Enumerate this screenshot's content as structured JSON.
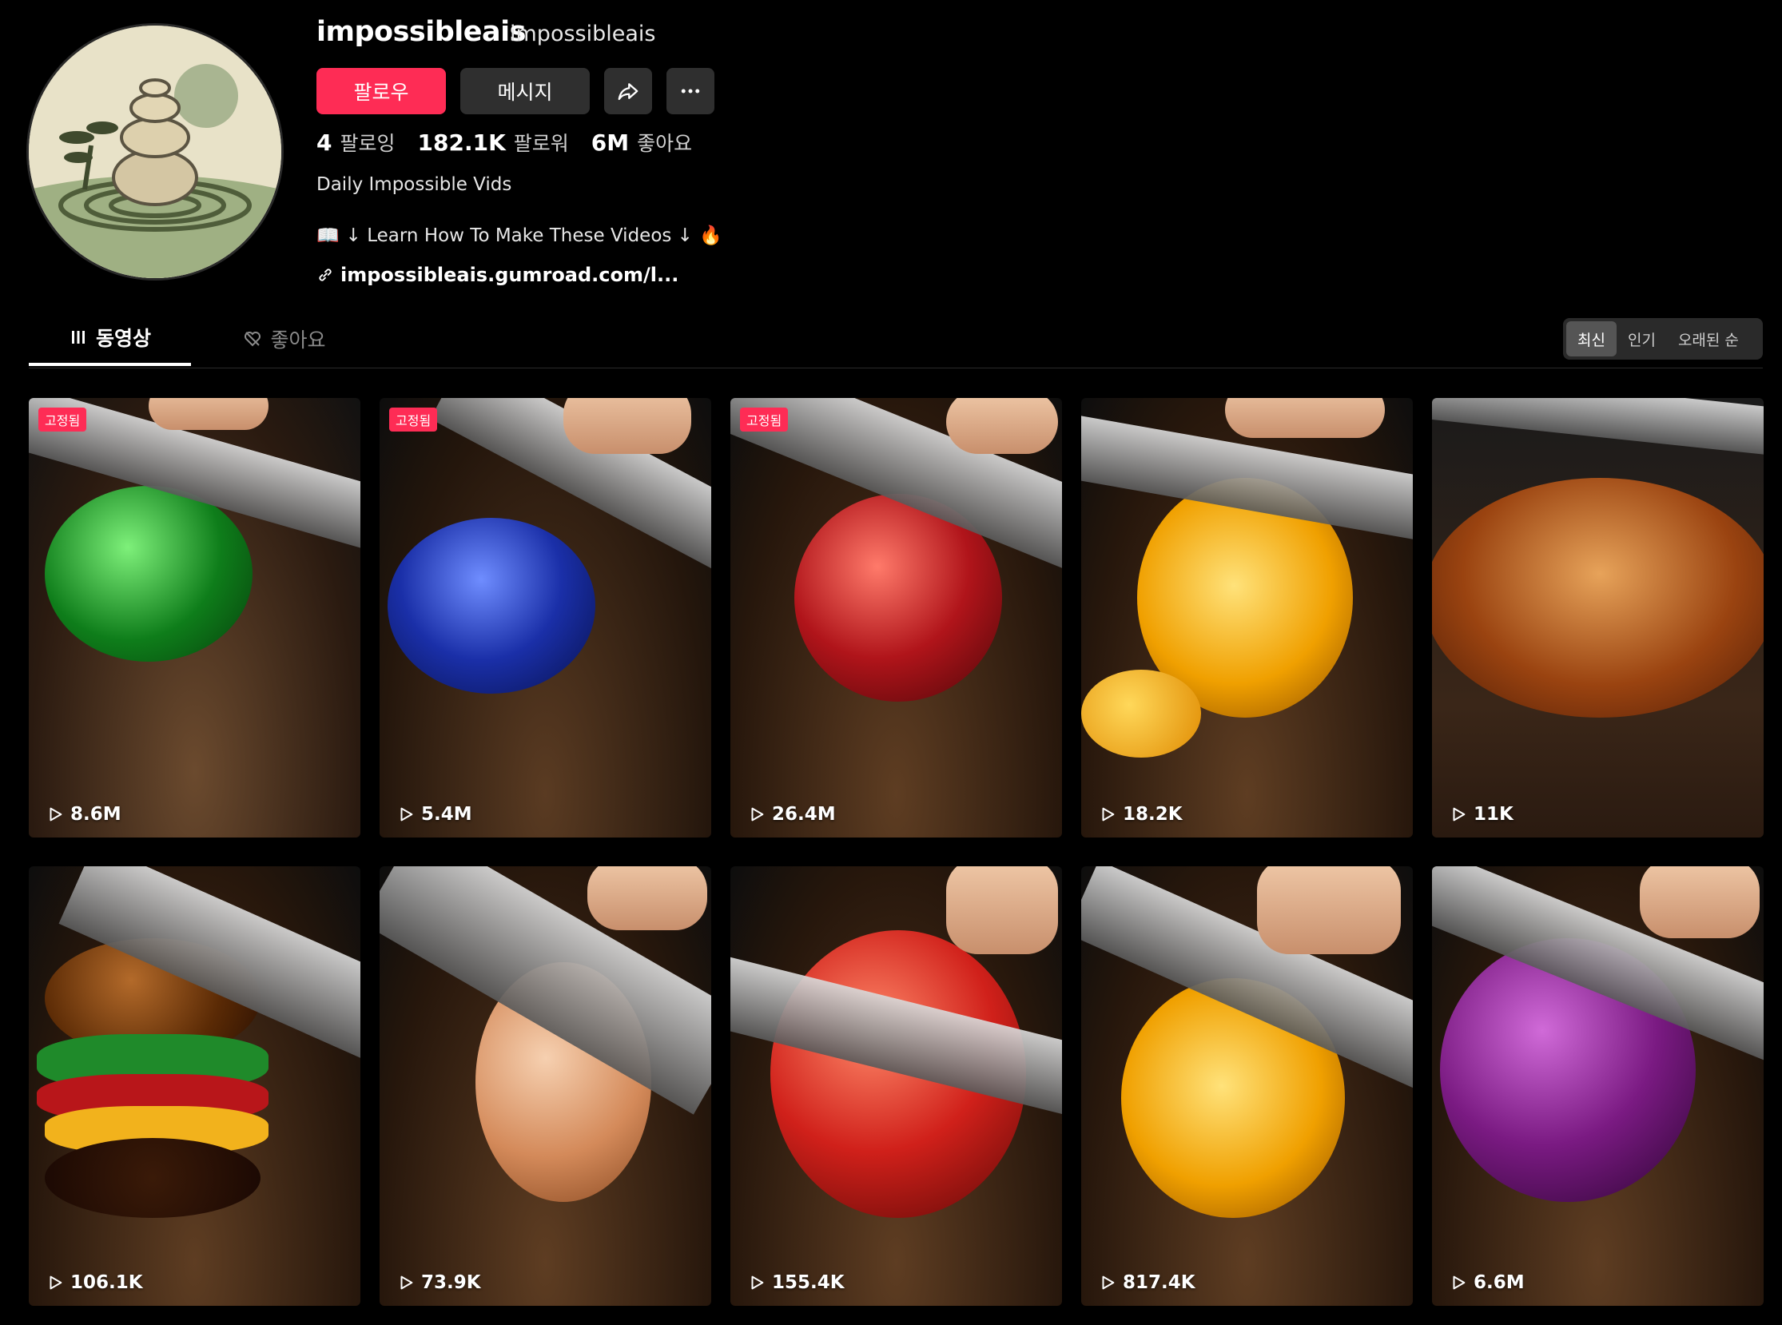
{
  "profile": {
    "username": "impossibleais",
    "nickname": "impossibleais",
    "follow_label": "팔로우",
    "message_label": "메시지",
    "share_icon": "share-icon",
    "more_icon": "more-icon",
    "following_count": "4",
    "following_label": "팔로잉",
    "followers_count": "182.1K",
    "followers_label": "팔로워",
    "likes_count": "6M",
    "likes_label": "좋아요",
    "bio_line1": "Daily Impossible Vids",
    "bio_line2": "↓ Learn How To Make These Videos ↓",
    "link": "impossibleais.gumroad.com/l..."
  },
  "tabs": {
    "videos_label": "동영상",
    "liked_label": "좋아요"
  },
  "sort": {
    "latest": "최신",
    "popular": "인기",
    "oldest": "오래된 순"
  },
  "videos": [
    {
      "views": "8.6M",
      "pinned": "고정됨",
      "subject": "green jelly fruit",
      "colors": [
        "#0e7d1a",
        "#2bbf3a"
      ]
    },
    {
      "views": "5.4M",
      "pinned": "고정됨",
      "subject": "blueberry glass",
      "colors": [
        "#0b1f80",
        "#3a5cff"
      ]
    },
    {
      "views": "26.4M",
      "pinned": "고정됨",
      "subject": "strawberry glass",
      "colors": [
        "#8f0f10",
        "#e23a2a"
      ]
    },
    {
      "views": "18.2K",
      "subject": "peach glass",
      "colors": [
        "#e08a00",
        "#ffcf40"
      ]
    },
    {
      "views": "11K",
      "subject": "sugared donut",
      "colors": [
        "#7a2e08",
        "#d98a3a"
      ]
    },
    {
      "views": "106.1K",
      "subject": "burger glass",
      "colors": [
        "#5a2a05",
        "#f0b020"
      ]
    },
    {
      "views": "73.9K",
      "subject": "egg glass",
      "colors": [
        "#c97a4a",
        "#f4c7a0"
      ]
    },
    {
      "views": "155.4K",
      "subject": "pomegranate glass",
      "colors": [
        "#9a0d0a",
        "#ff3b2a"
      ]
    },
    {
      "views": "817.4K",
      "subject": "golden strawberry",
      "colors": [
        "#c97a00",
        "#ffc53d"
      ]
    },
    {
      "views": "6.6M",
      "subject": "red onion glass",
      "colors": [
        "#4a0a4f",
        "#a52aa8"
      ]
    }
  ]
}
